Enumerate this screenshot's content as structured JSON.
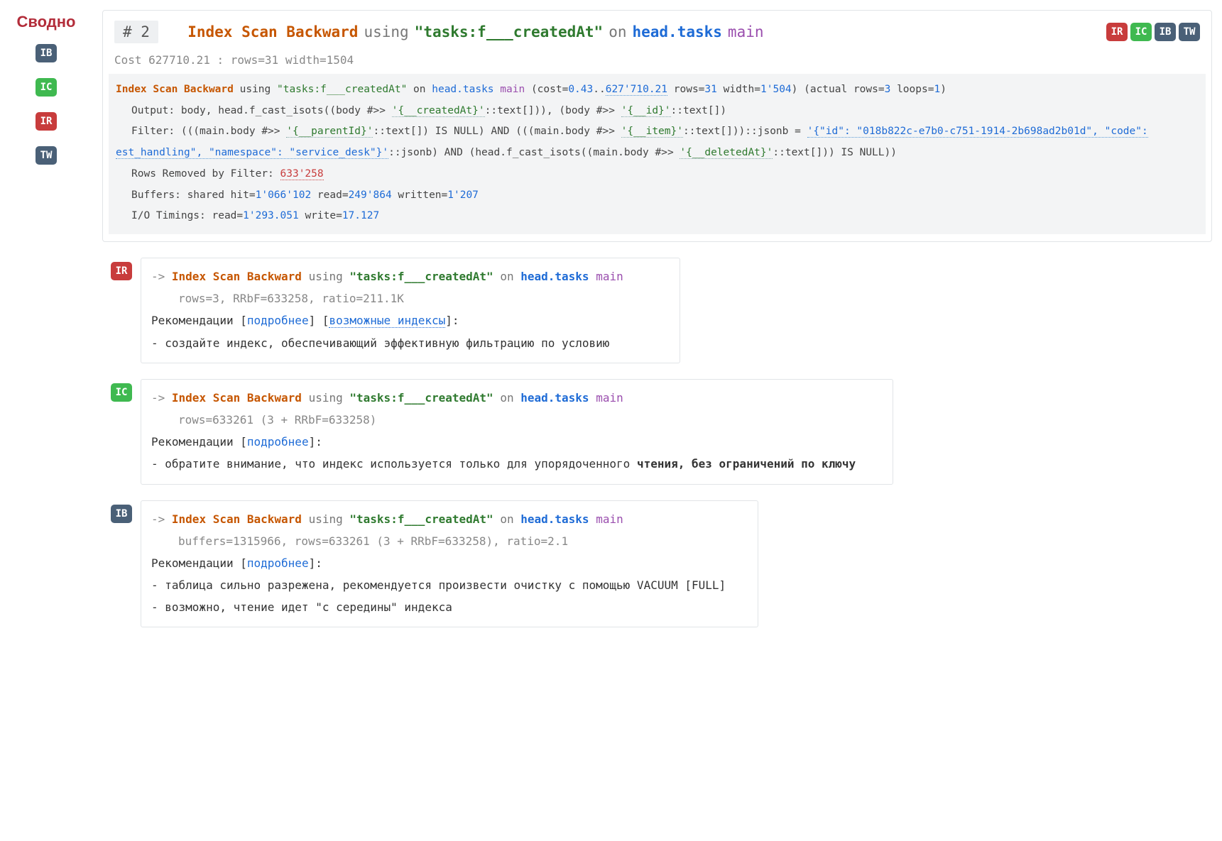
{
  "sidebar": {
    "title": "Сводно",
    "items": [
      "IB",
      "IC",
      "IR",
      "TW"
    ]
  },
  "header": {
    "node_num": "# 2",
    "op": "Index Scan Backward",
    "kw_using": "using",
    "index_name": "\"tasks:f___createdAt\"",
    "kw_on": "on",
    "table": "head.tasks",
    "alias": "main",
    "badges": [
      "IR",
      "IC",
      "IB",
      "TW"
    ]
  },
  "cost_line": "Cost 627710.21    : rows=31 width=1504",
  "raw": {
    "l1_a": "Index Scan Backward",
    "l1_b": " using ",
    "l1_c": "\"tasks:f___createdAt\"",
    "l1_d": " on ",
    "l1_e": "head.tasks",
    "l1_f": " main  ",
    "l1_g": "(cost=",
    "l1_cost_lo": "0.43",
    "l1_dots": "..",
    "l1_cost_hi": "627'710.21",
    "l1_rows_lbl": " rows=",
    "l1_rows": "31",
    "l1_w_lbl": " width=",
    "l1_w": "1'504",
    "l1_close": ") (actual rows=",
    "l1_act_rows": "3",
    "l1_loops_lbl": " loops=",
    "l1_loops": "1",
    "l1_end": ")",
    "l2_a": "Output: body, head.f_cast_isots((body #>> ",
    "l2_lit1": "'{__createdAt}'",
    "l2_b": "::text[])), (body #>> ",
    "l2_lit2": "'{__id}'",
    "l2_c": "::text[])",
    "l3_a": "Filter: (((main.body #>> ",
    "l3_lit1": "'{__parentId}'",
    "l3_b": "::text[]) IS NULL) AND (((main.body #>> ",
    "l3_lit2": "'{__item}'",
    "l3_c": "::text[]))::jsonb = ",
    "l3_json1": "'{\"id\": \"018b822c-e7b0-c751-1914-2b698ad2b01d\", \"code\":",
    "l3_json2": "est_handling\", \"namespace\": \"service_desk\"}'",
    "l3_d": "::jsonb) AND (head.f_cast_isots((main.body #>> ",
    "l3_lit3": "'{__deletedAt}'",
    "l3_e": "::text[])) IS NULL))",
    "l4_a": "Rows Removed by Filter: ",
    "l4_v": "633'258",
    "l5_a": "Buffers: shared hit=",
    "l5_hit": "1'066'102",
    "l5_b": " read=",
    "l5_read": "249'864",
    "l5_c": " written=",
    "l5_wr": "1'207",
    "l6_a": "I/O Timings: read=",
    "l6_read": "1'293.051",
    "l6_b": " write=",
    "l6_wr": "17.127"
  },
  "rec": [
    {
      "badge": "IR",
      "arrow": "-> ",
      "op": "Index Scan Backward",
      "kw_using": "using",
      "index": "\"tasks:f___createdAt\"",
      "kw_on": "on",
      "table": "head.tasks",
      "alias": "main",
      "sub": "rows=3, RRbF=633258, ratio=211.1K",
      "rec_label": "Рекомендации",
      "more": "подробнее",
      "extra_link": "возможные индексы",
      "tail": ":",
      "lines": [
        "- создайте индекс, обеспечивающий эффективную фильтрацию по условию"
      ]
    },
    {
      "badge": "IC",
      "arrow": "-> ",
      "op": "Index Scan Backward",
      "kw_using": "using",
      "index": "\"tasks:f___createdAt\"",
      "kw_on": "on",
      "table": "head.tasks",
      "alias": "main",
      "sub": "rows=633261 (3 + RRbF=633258)",
      "rec_label": "Рекомендации",
      "more": "подробнее",
      "tail": ":",
      "lines_plain": "- обратите внимание, что индекс используется только для упорядоченного ",
      "lines_strong": "чтения, без ограничений по ключу"
    },
    {
      "badge": "IB",
      "arrow": "-> ",
      "op": "Index Scan Backward",
      "kw_using": "using",
      "index": "\"tasks:f___createdAt\"",
      "kw_on": "on",
      "table": "head.tasks",
      "alias": "main",
      "sub": "buffers=1315966, rows=633261 (3 + RRbF=633258), ratio=2.1",
      "rec_label": "Рекомендации",
      "more": "подробнее",
      "tail": ":",
      "lines": [
        "- таблица сильно разрежена, рекомендуется произвести очистку с помощью VACUUM [FULL]",
        "- возможно, чтение идет \"с середины\" индекса"
      ]
    }
  ]
}
